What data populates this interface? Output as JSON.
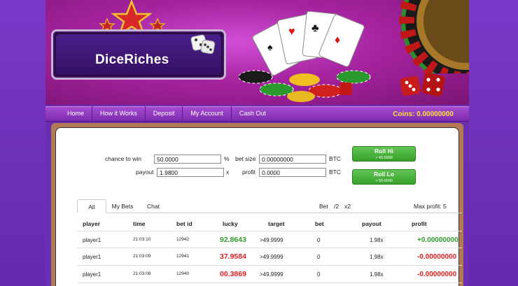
{
  "brand": {
    "name": "DiceRiches"
  },
  "nav": {
    "items": [
      "Home",
      "How it Works",
      "Deposit",
      "My Account",
      "Cash Out"
    ],
    "coins_label": "Coins:",
    "coins_value": "0.00000000"
  },
  "form": {
    "chance_label": "chance to win",
    "chance_value": "50.0000",
    "chance_unit": "%",
    "payout_label": "payout",
    "payout_value": "1.9800",
    "payout_unit": "x",
    "betsize_label": "bet size",
    "betsize_value": "0.00000000",
    "betsize_unit": "BTC",
    "profit_label": "profit",
    "profit_value": "0.0000",
    "profit_unit": "BTC",
    "roll_hi_label": "Roll Hi",
    "roll_hi_sub": "> 49.9999",
    "roll_lo_label": "Roll Lo",
    "roll_lo_sub": "< 50.0000"
  },
  "tabs": [
    "All",
    "My Bets",
    "Chat"
  ],
  "bet_controls": {
    "label": "Bet",
    "half": "/2",
    "double": "x2",
    "max_profit": "Max profit: 5"
  },
  "table": {
    "headers": [
      "player",
      "time",
      "bet id",
      "lucky",
      "target",
      "bet",
      "payout",
      "profit"
    ],
    "rows": [
      {
        "player": "player1",
        "time": "21:03:10",
        "bet_id": "12942",
        "lucky": "92.8643",
        "target": ">49.9999",
        "bet": "0",
        "payout": "1.98x",
        "profit": "+0.00000000"
      },
      {
        "player": "player1",
        "time": "21:03:09",
        "bet_id": "12941",
        "lucky": "37.9584",
        "target": ">49.9999",
        "bet": "0",
        "payout": "1.98x",
        "profit": "-0.00000000"
      },
      {
        "player": "player1",
        "time": "21:03:08",
        "bet_id": "12940",
        "lucky": "00.3869",
        "target": ">49.9999",
        "bet": "0",
        "payout": "1.98x",
        "profit": "-0.00000000"
      }
    ]
  },
  "colors": {
    "win": "#2f9a2a",
    "loss": "#e02020",
    "coins": "#ffe23a",
    "accent_purple": "#7c2bb0"
  },
  "icons": [
    "star-icon",
    "dice-icon",
    "playing-cards-icon",
    "roulette-wheel-icon",
    "poker-chips-icon"
  ]
}
